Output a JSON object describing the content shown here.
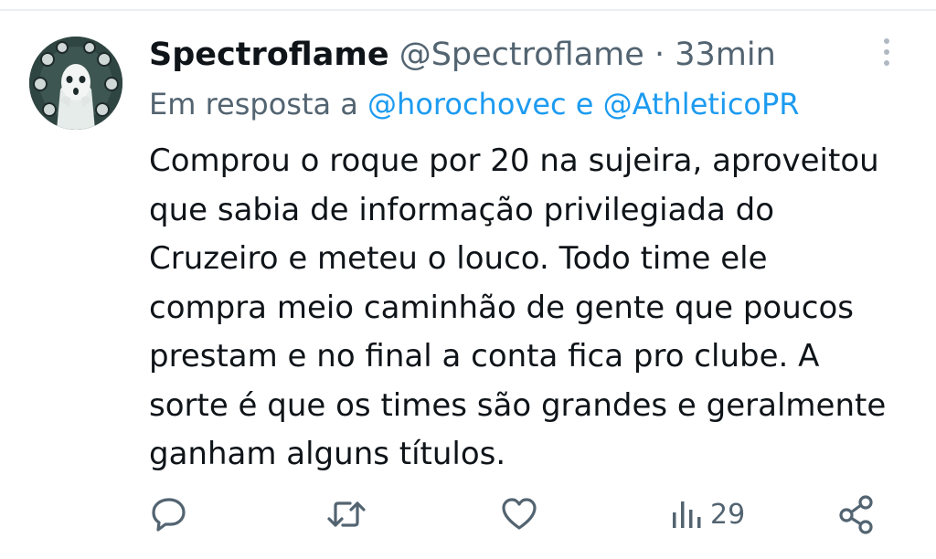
{
  "tweet": {
    "display_name": "Spectroflame",
    "handle": "@Spectroflame",
    "separator": "·",
    "time": "33min",
    "reply_prefix": "Em resposta a",
    "reply_mention_1": "@horochovec",
    "reply_conjunction": "e",
    "reply_mention_2": "@AthleticoPR",
    "text_lines": [
      "Comprou o roque por 20 na sujeira, aproveitou",
      "que sabia de informação privilegiada do",
      "Cruzeiro e meteu o louco. Todo time ele",
      "compra meio caminhão de gente que poucos",
      "prestam e no final a conta fica pro clube. A",
      "sorte é que os times são grandes e geralmente",
      "ganham alguns títulos."
    ]
  },
  "actions": {
    "views_count": "29"
  },
  "icons": {
    "reply": "reply-icon",
    "retweet": "retweet-icon",
    "like": "heart-icon",
    "views": "views-icon",
    "share": "share-icon",
    "more": "more-icon"
  },
  "colors": {
    "text": "#0f1419",
    "secondary": "#536471",
    "link": "#1d9bf0"
  }
}
